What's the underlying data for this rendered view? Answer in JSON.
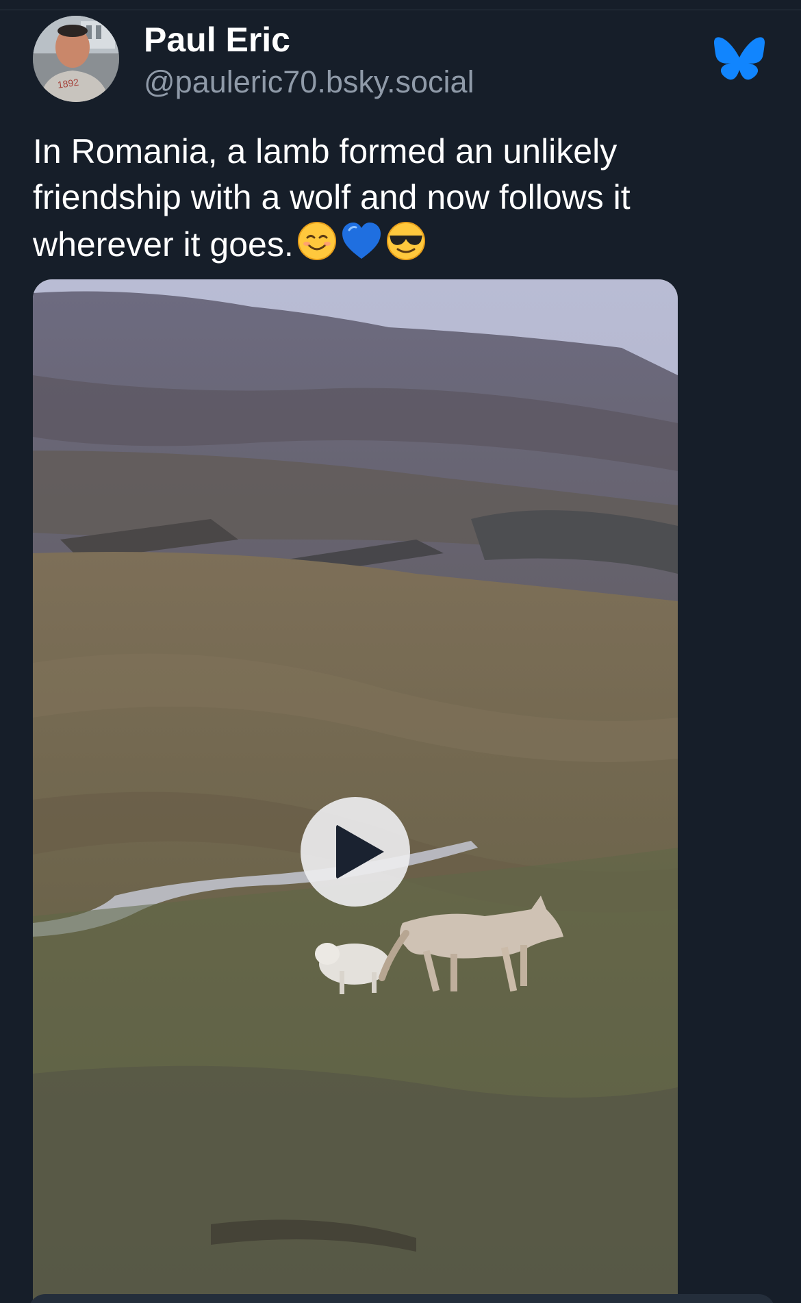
{
  "author": {
    "display_name": "Paul Eric",
    "handle": "@pauleric70.bsky.social",
    "avatar_shirt_text": "1892"
  },
  "post": {
    "text": "In Romania, a lamb formed an unlikely friendship with a wolf and now follows it wherever it goes.",
    "emojis": [
      "smiling-face-icon",
      "blue-heart-icon",
      "sunglasses-face-icon"
    ]
  },
  "media": {
    "type": "video",
    "scene": "wolf and lamb walking across a grassy hillside",
    "play_icon": "play-icon"
  },
  "colors": {
    "background": "#161e29",
    "text": "#ffffff",
    "secondary_text": "#8f9aa8",
    "brand_blue": "#1185fe"
  }
}
